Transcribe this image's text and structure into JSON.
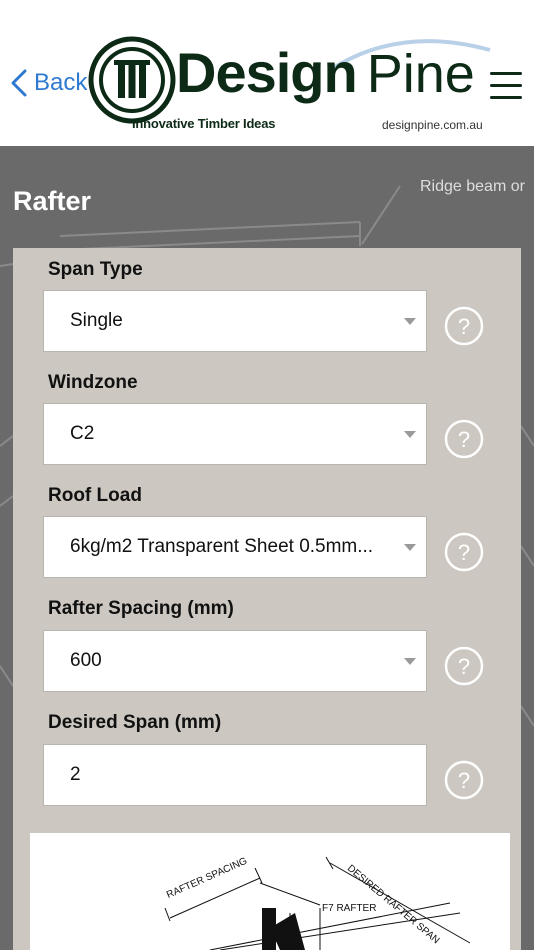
{
  "header": {
    "back_label": "Back",
    "logo_design": "Design",
    "logo_pine": "Pine",
    "tagline": "Innovative Timber Ideas",
    "website": "designpine.com.au"
  },
  "background": {
    "callout": "Ridge beam or"
  },
  "page": {
    "title": "Rafter"
  },
  "form": {
    "span_type": {
      "label": "Span Type",
      "value": "Single"
    },
    "windzone": {
      "label": "Windzone",
      "value": "C2"
    },
    "roof_load": {
      "label": "Roof Load",
      "value": "6kg/m2 Transparent Sheet 0.5mm..."
    },
    "rafter_spacing": {
      "label": "Rafter Spacing (mm)",
      "value": "600"
    },
    "desired_span": {
      "label": "Desired Span (mm)",
      "value": "2"
    }
  },
  "diagram": {
    "rafter_spacing": "RAFTER SPACING",
    "f7_rafter": "F7 RAFTER",
    "desired_span": "DESIRED RAFTER SPAN"
  },
  "colors": {
    "accent": "#2f7ad1",
    "brand_dark": "#0c2a16",
    "panel": "#ccc8c1",
    "background": "#6a6a6a"
  }
}
